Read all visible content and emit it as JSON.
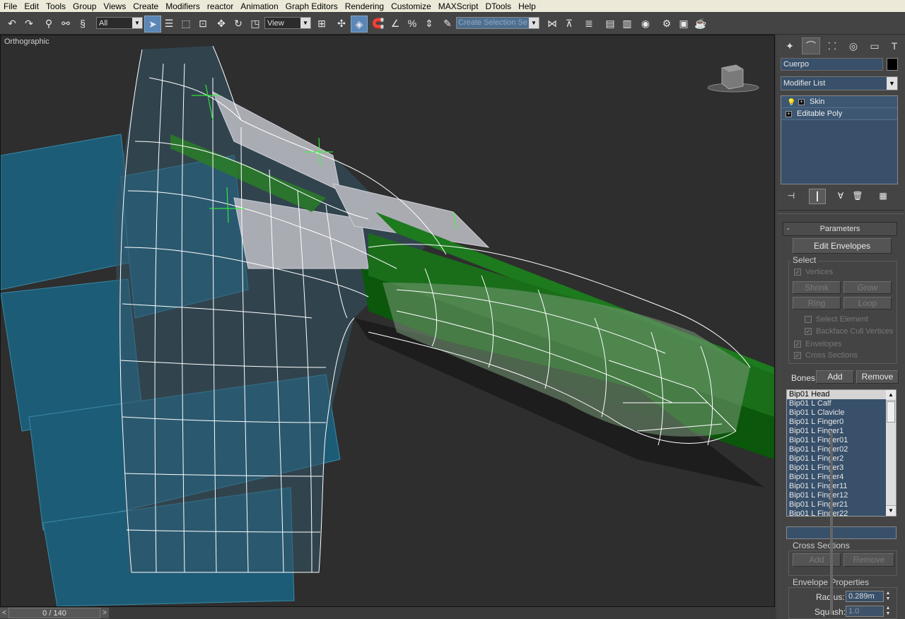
{
  "menu": [
    "File",
    "Edit",
    "Tools",
    "Group",
    "Views",
    "Create",
    "Modifiers",
    "reactor",
    "Animation",
    "Graph Editors",
    "Rendering",
    "Customize",
    "MAXScript",
    "DTools",
    "Help"
  ],
  "toolbar": {
    "filter_value": "All",
    "refcoord_value": "View",
    "selection_set_placeholder": "Create Selection Se"
  },
  "viewport": {
    "label": "Orthographic"
  },
  "timeslider": {
    "frame_label": "0 / 140",
    "prev": "<",
    "next": ">"
  },
  "panel": {
    "object_name": "Cuerpo",
    "object_color": "#000000",
    "modifier_list_label": "Modifier List",
    "stack": [
      {
        "name": "Skin",
        "selected": true
      },
      {
        "name": "Editable Poly",
        "selected": false
      }
    ],
    "parameters": {
      "title": "Parameters",
      "collapse": "-",
      "edit_envelopes": "Edit Envelopes",
      "select_group": "Select",
      "vertices": "Vertices",
      "shrink": "Shrink",
      "grow": "Grow",
      "ring": "Ring",
      "loop": "Loop",
      "select_element": "Select Element",
      "backface_cull": "Backface Cull Vertices",
      "envelopes": "Envelopes",
      "cross_sections": "Cross Sections",
      "bones_label": "Bones:",
      "add": "Add",
      "remove": "Remove",
      "bones": [
        "Bip01 Head",
        "Bip01 L Calf",
        "Bip01 L Clavicle",
        "Bip01 L Finger0",
        "Bip01 L Finger1",
        "Bip01 L Finger01",
        "Bip01 L Finger02",
        "Bip01 L Finger2",
        "Bip01 L Finger3",
        "Bip01 L Finger4",
        "Bip01 L Finger11",
        "Bip01 L Finger12",
        "Bip01 L Finger21",
        "Bip01 L Finger22"
      ],
      "cross_sections_group": "Cross Sections",
      "cs_add": "Add",
      "cs_remove": "Remove",
      "envelope_props": "Envelope Properties",
      "radius_label": "Radius:",
      "radius_value": "0.289m",
      "squash_label": "Squash:",
      "squash_value": "1.0"
    }
  }
}
